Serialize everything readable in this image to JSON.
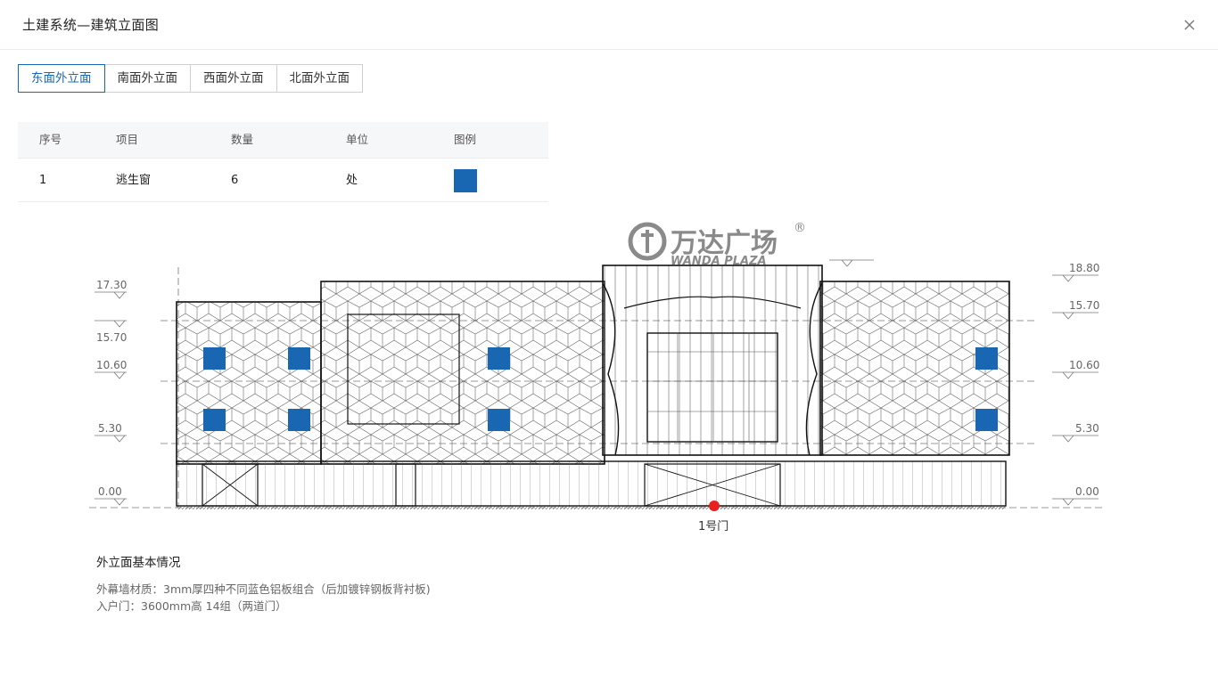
{
  "header": {
    "title": "土建系统—建筑立面图",
    "close_icon": "close-icon"
  },
  "tabs": [
    {
      "label": "东面外立面",
      "active": true
    },
    {
      "label": "南面外立面",
      "active": false
    },
    {
      "label": "西面外立面",
      "active": false
    },
    {
      "label": "北面外立面",
      "active": false
    }
  ],
  "table": {
    "headers": [
      "序号",
      "项目",
      "数量",
      "单位",
      "图例"
    ],
    "rows": [
      {
        "no": "1",
        "item": "逃生窗",
        "qty": "6",
        "unit": "处",
        "legend_color": "#1967b3"
      }
    ]
  },
  "drawing": {
    "brand": {
      "cn": "万达广场",
      "en": "WANDA PLAZA",
      "mark": "®"
    },
    "left_levels": [
      "17.30",
      "15.70",
      "10.60",
      "5.30",
      "0.00"
    ],
    "right_levels": [
      "18.80",
      "15.70",
      "10.60",
      "5.30",
      "0.00"
    ],
    "door_label": "1号门",
    "window_color": "#1967b3",
    "door_marker_color": "#e82020"
  },
  "info": {
    "title": "外立面基本情况",
    "lines": [
      "外幕墙材质：3mm厚四种不同蓝色铝板组合（后加镀锌钢板背衬板)",
      "入户门：3600mm高 14组（两道门）"
    ]
  }
}
